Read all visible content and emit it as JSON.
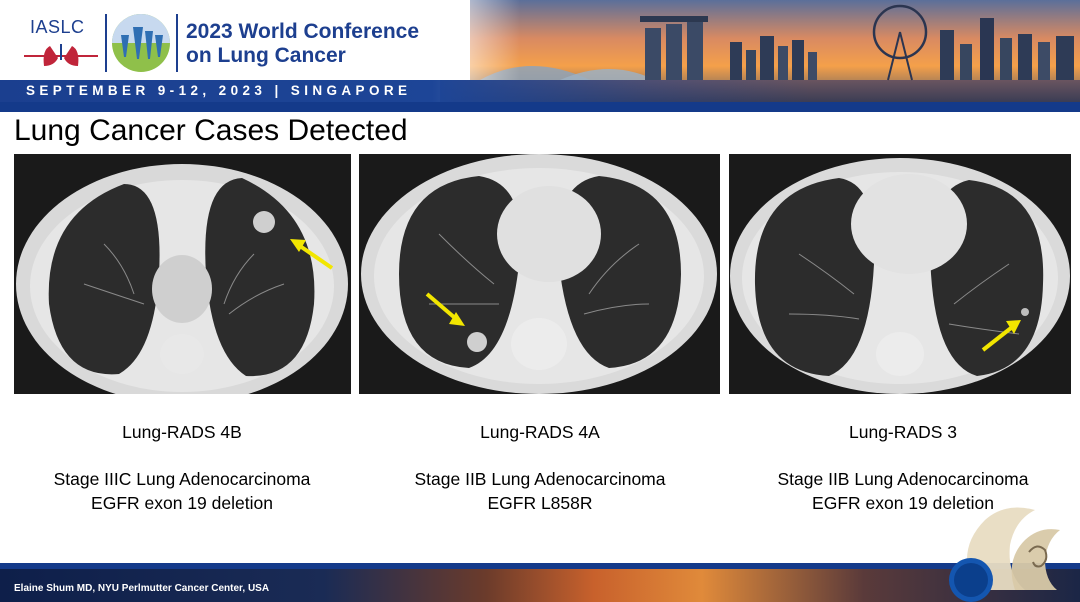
{
  "header": {
    "org": "IASLC",
    "conference_title_line1": "2023 World Conference",
    "conference_title_line2": "on Lung Cancer",
    "date_location": "SEPTEMBER 9-12, 2023 | SINGAPORE"
  },
  "slide": {
    "title": "Lung Cancer Cases Detected"
  },
  "cases": [
    {
      "lung_rads": "Lung-RADS 4B",
      "stage": "Stage IIIC Lung Adenocarcinoma",
      "mutation": "EGFR exon 19 deletion"
    },
    {
      "lung_rads": "Lung-RADS 4A",
      "stage": "Stage IIB Lung Adenocarcinoma",
      "mutation": "EGFR L858R"
    },
    {
      "lung_rads": "Lung-RADS 3",
      "stage": "Stage IIB Lung Adenocarcinoma",
      "mutation": "EGFR exon 19 deletion"
    }
  ],
  "footer": {
    "presenter": "Elaine Shum MD, NYU Perlmutter Cancer Center, USA"
  },
  "colors": {
    "brand_blue": "#1d3f8f",
    "arrow_yellow": "#f2e600"
  }
}
